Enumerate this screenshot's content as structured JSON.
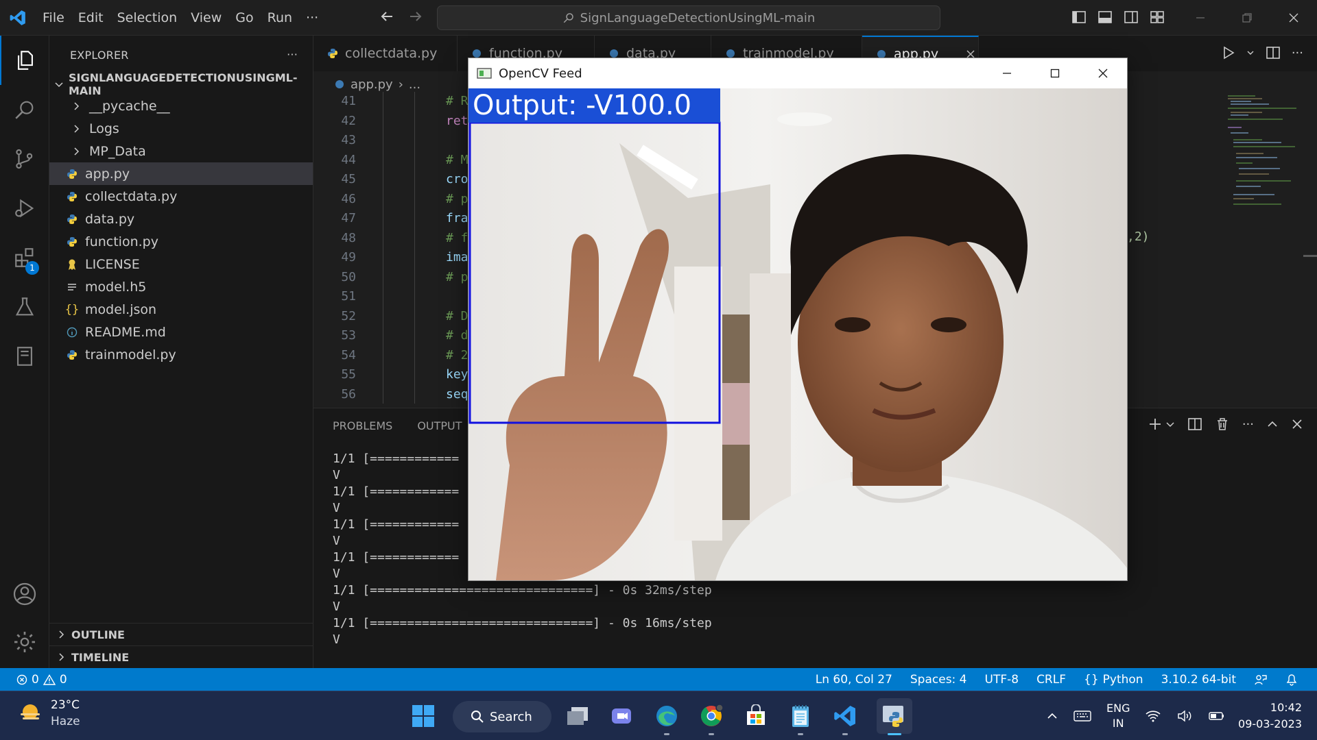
{
  "titlebar": {
    "menu": [
      "File",
      "Edit",
      "Selection",
      "View",
      "Go",
      "Run"
    ],
    "more": "···",
    "search": "SignLanguageDetectionUsingML-main"
  },
  "activity": {
    "extensions_badge": "1"
  },
  "sidebar": {
    "title": "EXPLORER",
    "more": "···",
    "root": "SIGNLANGUAGEDETECTIONUSINGML-MAIN",
    "items": [
      {
        "label": "__pycache__",
        "kind": "folder"
      },
      {
        "label": "Logs",
        "kind": "folder"
      },
      {
        "label": "MP_Data",
        "kind": "folder"
      },
      {
        "label": "app.py",
        "kind": "python",
        "selected": true
      },
      {
        "label": "collectdata.py",
        "kind": "python"
      },
      {
        "label": "data.py",
        "kind": "python"
      },
      {
        "label": "function.py",
        "kind": "python"
      },
      {
        "label": "LICENSE",
        "kind": "license"
      },
      {
        "label": "model.h5",
        "kind": "text"
      },
      {
        "label": "model.json",
        "kind": "json"
      },
      {
        "label": "README.md",
        "kind": "info"
      },
      {
        "label": "trainmodel.py",
        "kind": "python"
      }
    ],
    "outline": "OUTLINE",
    "timeline": "TIMELINE"
  },
  "tabs": [
    "collectdata.py",
    "function.py",
    "data.py",
    "trainmodel.py",
    "app.py"
  ],
  "breadcrumb": {
    "file": "app.py",
    "rest": "..."
  },
  "editor": {
    "lines": [
      {
        "n": "41",
        "text": "# R",
        "type": "comment"
      },
      {
        "n": "42",
        "text": "ret",
        "type": "kw"
      },
      {
        "n": "43",
        "text": "",
        "type": "plain"
      },
      {
        "n": "44",
        "text": "# M",
        "type": "comment"
      },
      {
        "n": "45",
        "text": "cro",
        "type": "var"
      },
      {
        "n": "46",
        "text": "# p",
        "type": "comment"
      },
      {
        "n": "47",
        "text": "fra",
        "type": "var"
      },
      {
        "n": "48",
        "text": "# f",
        "type": "comment"
      },
      {
        "n": "49",
        "text": "ima",
        "type": "var"
      },
      {
        "n": "50",
        "text": "# p",
        "type": "comment"
      },
      {
        "n": "51",
        "text": "",
        "type": "plain"
      },
      {
        "n": "52",
        "text": "# D",
        "type": "comment"
      },
      {
        "n": "53",
        "text": "# d",
        "type": "comment"
      },
      {
        "n": "54",
        "text": "# 2",
        "type": "comment"
      },
      {
        "n": "55",
        "text": "key",
        "type": "var"
      },
      {
        "n": "56",
        "text": "seq",
        "type": "var"
      }
    ],
    "overflow_text": ",2)"
  },
  "panel": {
    "tabs": [
      "PROBLEMS",
      "OUTPUT"
    ],
    "terminal": [
      "1/1 [============",
      "V",
      "1/1 [============",
      "V",
      "1/1 [============",
      "V",
      "1/1 [============",
      "V",
      "1/1 [==============================] - 0s 32ms/step",
      "V",
      "1/1 [==============================] - 0s 16ms/step",
      "V"
    ]
  },
  "statusbar": {
    "errors": "0",
    "warnings": "0",
    "position": "Ln 60, Col 27",
    "spaces": "Spaces: 4",
    "encoding": "UTF-8",
    "eol": "CRLF",
    "language": "Python",
    "interpreter": "3.10.2 64-bit"
  },
  "opencv": {
    "title": "OpenCV Feed",
    "output_label": "Output: -V100.0"
  },
  "taskbar": {
    "temp": "23°C",
    "condition": "Haze",
    "search": "Search",
    "lang_top": "ENG",
    "lang_bottom": "IN",
    "time": "10:42",
    "date": "09-03-2023"
  }
}
